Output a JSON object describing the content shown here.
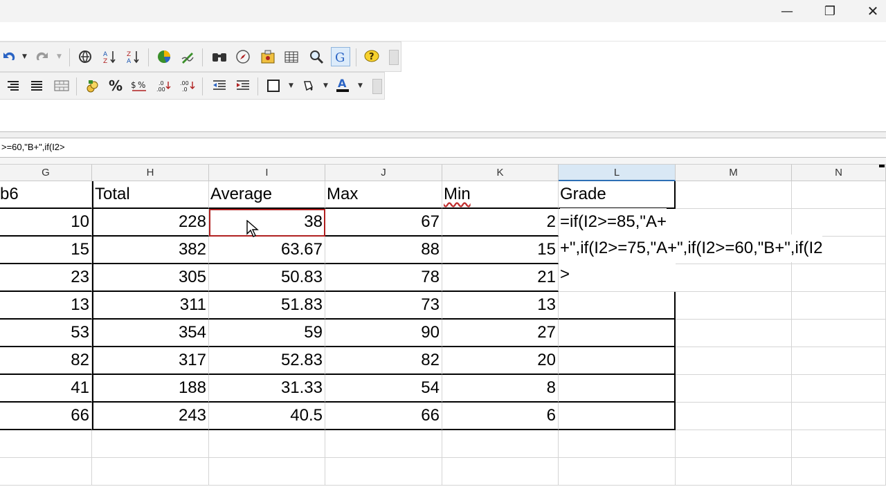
{
  "formula_bar": {
    "text": ">=60,\"B+\",if(I2>"
  },
  "columns": [
    "G",
    "H",
    "I",
    "J",
    "K",
    "L",
    "M",
    "N"
  ],
  "headers": {
    "g": "b6",
    "h": "Total",
    "i": "Average",
    "j": "Max",
    "k": "Min",
    "l": "Grade"
  },
  "rows": [
    {
      "g": "10",
      "h": "228",
      "i": "38",
      "j": "67",
      "k": "2"
    },
    {
      "g": "15",
      "h": "382",
      "i": "63.67",
      "j": "88",
      "k": "15"
    },
    {
      "g": "23",
      "h": "305",
      "i": "50.83",
      "j": "78",
      "k": "21"
    },
    {
      "g": "13",
      "h": "311",
      "i": "51.83",
      "j": "73",
      "k": "13"
    },
    {
      "g": "53",
      "h": "354",
      "i": "59",
      "j": "90",
      "k": "27"
    },
    {
      "g": "82",
      "h": "317",
      "i": "52.83",
      "j": "82",
      "k": "20"
    },
    {
      "g": "41",
      "h": "188",
      "i": "31.33",
      "j": "54",
      "k": "8"
    },
    {
      "g": "66",
      "h": "243",
      "i": "40.5",
      "j": "66",
      "k": "6"
    }
  ],
  "editing_formula": {
    "line1": "=if(I2>=85,\"A+",
    "line2": "+\",if(I2>=75,\"A+\",if(I2>=60,\"B+\",if(I2",
    "line3": ">"
  },
  "window": {
    "minimize": "—",
    "restore": "❐",
    "close": "✕"
  },
  "colors": {
    "selected_col_header": "#d9e8f5",
    "active_cell_border": "#b02020"
  }
}
